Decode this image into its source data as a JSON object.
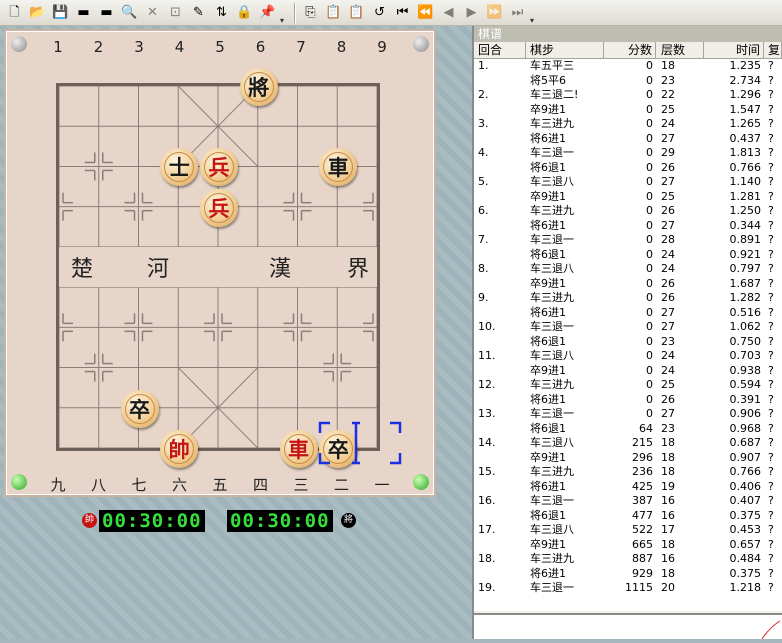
{
  "toolbar": {
    "groups": [
      [
        {
          "name": "new-file-icon",
          "glyph": "🗋",
          "disabled": false
        },
        {
          "name": "open-folder-icon",
          "glyph": "📂",
          "disabled": false
        },
        {
          "name": "save-icon",
          "glyph": "💾",
          "disabled": false
        },
        {
          "name": "red-board-icon",
          "glyph": "▬",
          "disabled": false
        },
        {
          "name": "black-board-icon",
          "glyph": "▬",
          "disabled": false
        },
        {
          "name": "search-icon",
          "glyph": "🔍",
          "disabled": false
        },
        {
          "name": "stop-icon",
          "glyph": "✕",
          "disabled": true
        },
        {
          "name": "hint-icon",
          "glyph": "⊡",
          "disabled": true
        },
        {
          "name": "edit-icon",
          "glyph": "✎",
          "disabled": false
        },
        {
          "name": "flip-board-icon",
          "glyph": "⇅",
          "disabled": false
        },
        {
          "name": "lock-icon",
          "glyph": "🔒",
          "disabled": false
        },
        {
          "name": "pin-icon",
          "glyph": "📌",
          "disabled": false
        }
      ],
      [
        {
          "name": "copy-icon",
          "glyph": "⎘",
          "disabled": false
        },
        {
          "name": "paste-icon",
          "glyph": "📋",
          "disabled": false
        },
        {
          "name": "paste-board-icon",
          "glyph": "📋",
          "disabled": false
        },
        {
          "name": "undo-icon",
          "glyph": "↺",
          "disabled": false
        },
        {
          "name": "first-move-icon",
          "glyph": "⏮",
          "disabled": false
        },
        {
          "name": "prev-move-icon",
          "glyph": "⏪",
          "disabled": false
        },
        {
          "name": "back-icon",
          "glyph": "◀",
          "disabled": true
        },
        {
          "name": "forward-icon",
          "glyph": "▶",
          "disabled": true
        },
        {
          "name": "next-move-icon",
          "glyph": "⏩",
          "disabled": true
        },
        {
          "name": "last-move-icon",
          "glyph": "⏭",
          "disabled": true
        }
      ]
    ]
  },
  "board": {
    "top_files": [
      "1",
      "2",
      "3",
      "4",
      "5",
      "6",
      "7",
      "8",
      "9"
    ],
    "bottom_files": [
      "九",
      "八",
      "七",
      "六",
      "五",
      "四",
      "三",
      "二",
      "一"
    ],
    "river_left": [
      "楚",
      "河"
    ],
    "river_right": [
      "漢",
      "界"
    ],
    "pieces": [
      {
        "label": "將",
        "side": "black",
        "name": "black-general"
      },
      {
        "label": "士",
        "side": "black",
        "name": "black-advisor"
      },
      {
        "label": "兵",
        "side": "red",
        "name": "red-soldier-upper"
      },
      {
        "label": "車",
        "side": "black",
        "name": "black-chariot"
      },
      {
        "label": "兵",
        "side": "red",
        "name": "red-soldier-lower"
      },
      {
        "label": "卒",
        "side": "black",
        "name": "black-pawn-left"
      },
      {
        "label": "帥",
        "side": "red",
        "name": "red-general"
      },
      {
        "label": "車",
        "side": "red",
        "name": "red-chariot"
      },
      {
        "label": "卒",
        "side": "black",
        "name": "black-pawn-selected"
      }
    ]
  },
  "clock": {
    "red_label": "帥",
    "black_label": "將",
    "red_time": "00:30:00",
    "black_time": "00:30:00"
  },
  "panel": {
    "title": "棋谱",
    "columns": [
      "回合",
      "棋步",
      "分数",
      "层数",
      "时间",
      "复"
    ],
    "rows": [
      {
        "round": "1.",
        "move": "车五平三",
        "score": "0",
        "depth": "18",
        "time": "1.235",
        "flag": "?"
      },
      {
        "round": "",
        "move": "将5平6",
        "score": "0",
        "depth": "23",
        "time": "2.734",
        "flag": "?"
      },
      {
        "round": "2.",
        "move": "车三退二!",
        "score": "0",
        "depth": "22",
        "time": "1.296",
        "flag": "?"
      },
      {
        "round": "",
        "move": "卒9进1",
        "score": "0",
        "depth": "25",
        "time": "1.547",
        "flag": "?"
      },
      {
        "round": "3.",
        "move": "车三进九",
        "score": "0",
        "depth": "24",
        "time": "1.265",
        "flag": "?"
      },
      {
        "round": "",
        "move": "将6进1",
        "score": "0",
        "depth": "27",
        "time": "0.437",
        "flag": "?"
      },
      {
        "round": "4.",
        "move": "车三退一",
        "score": "0",
        "depth": "29",
        "time": "1.813",
        "flag": "?"
      },
      {
        "round": "",
        "move": "将6退1",
        "score": "0",
        "depth": "26",
        "time": "0.766",
        "flag": "?"
      },
      {
        "round": "5.",
        "move": "车三退八",
        "score": "0",
        "depth": "27",
        "time": "1.140",
        "flag": "?"
      },
      {
        "round": "",
        "move": "卒9进1",
        "score": "0",
        "depth": "25",
        "time": "1.281",
        "flag": "?"
      },
      {
        "round": "6.",
        "move": "车三进九",
        "score": "0",
        "depth": "26",
        "time": "1.250",
        "flag": "?"
      },
      {
        "round": "",
        "move": "将6进1",
        "score": "0",
        "depth": "27",
        "time": "0.344",
        "flag": "?"
      },
      {
        "round": "7.",
        "move": "车三退一",
        "score": "0",
        "depth": "28",
        "time": "0.891",
        "flag": "?"
      },
      {
        "round": "",
        "move": "将6退1",
        "score": "0",
        "depth": "24",
        "time": "0.921",
        "flag": "?"
      },
      {
        "round": "8.",
        "move": "车三退八",
        "score": "0",
        "depth": "24",
        "time": "0.797",
        "flag": "?"
      },
      {
        "round": "",
        "move": "卒9进1",
        "score": "0",
        "depth": "26",
        "time": "1.687",
        "flag": "?"
      },
      {
        "round": "9.",
        "move": "车三进九",
        "score": "0",
        "depth": "26",
        "time": "1.282",
        "flag": "?"
      },
      {
        "round": "",
        "move": "将6进1",
        "score": "0",
        "depth": "27",
        "time": "0.516",
        "flag": "?"
      },
      {
        "round": "10.",
        "move": "车三退一",
        "score": "0",
        "depth": "27",
        "time": "1.062",
        "flag": "?"
      },
      {
        "round": "",
        "move": "将6退1",
        "score": "0",
        "depth": "23",
        "time": "0.750",
        "flag": "?"
      },
      {
        "round": "11.",
        "move": "车三退八",
        "score": "0",
        "depth": "24",
        "time": "0.703",
        "flag": "?"
      },
      {
        "round": "",
        "move": "卒9进1",
        "score": "0",
        "depth": "24",
        "time": "0.938",
        "flag": "?"
      },
      {
        "round": "12.",
        "move": "车三进九",
        "score": "0",
        "depth": "25",
        "time": "0.594",
        "flag": "?"
      },
      {
        "round": "",
        "move": "将6进1",
        "score": "0",
        "depth": "26",
        "time": "0.391",
        "flag": "?"
      },
      {
        "round": "13.",
        "move": "车三退一",
        "score": "0",
        "depth": "27",
        "time": "0.906",
        "flag": "?"
      },
      {
        "round": "",
        "move": "将6退1",
        "score": "64",
        "depth": "23",
        "time": "0.968",
        "flag": "?"
      },
      {
        "round": "14.",
        "move": "车三退八",
        "score": "215",
        "depth": "18",
        "time": "0.687",
        "flag": "?"
      },
      {
        "round": "",
        "move": "卒9进1",
        "score": "296",
        "depth": "18",
        "time": "0.907",
        "flag": "?"
      },
      {
        "round": "15.",
        "move": "车三进九",
        "score": "236",
        "depth": "18",
        "time": "0.766",
        "flag": "?"
      },
      {
        "round": "",
        "move": "将6进1",
        "score": "425",
        "depth": "19",
        "time": "0.406",
        "flag": "?"
      },
      {
        "round": "16.",
        "move": "车三退一",
        "score": "387",
        "depth": "16",
        "time": "0.407",
        "flag": "?"
      },
      {
        "round": "",
        "move": "将6退1",
        "score": "477",
        "depth": "16",
        "time": "0.375",
        "flag": "?"
      },
      {
        "round": "17.",
        "move": "车三退八",
        "score": "522",
        "depth": "17",
        "time": "0.453",
        "flag": "?"
      },
      {
        "round": "",
        "move": "卒9进1",
        "score": "665",
        "depth": "18",
        "time": "0.657",
        "flag": "?"
      },
      {
        "round": "18.",
        "move": "车三进九",
        "score": "887",
        "depth": "16",
        "time": "0.484",
        "flag": "?"
      },
      {
        "round": "",
        "move": "将6进1",
        "score": "929",
        "depth": "18",
        "time": "0.375",
        "flag": "?"
      },
      {
        "round": "19.",
        "move": "车三退一",
        "score": "1115",
        "depth": "20",
        "time": "1.218",
        "flag": "?"
      }
    ]
  },
  "colors": {
    "red_piece": "#c51414",
    "black_piece": "#1a1a1a",
    "clock_digits": "#36e03c",
    "selection": "#1b2fe0"
  }
}
